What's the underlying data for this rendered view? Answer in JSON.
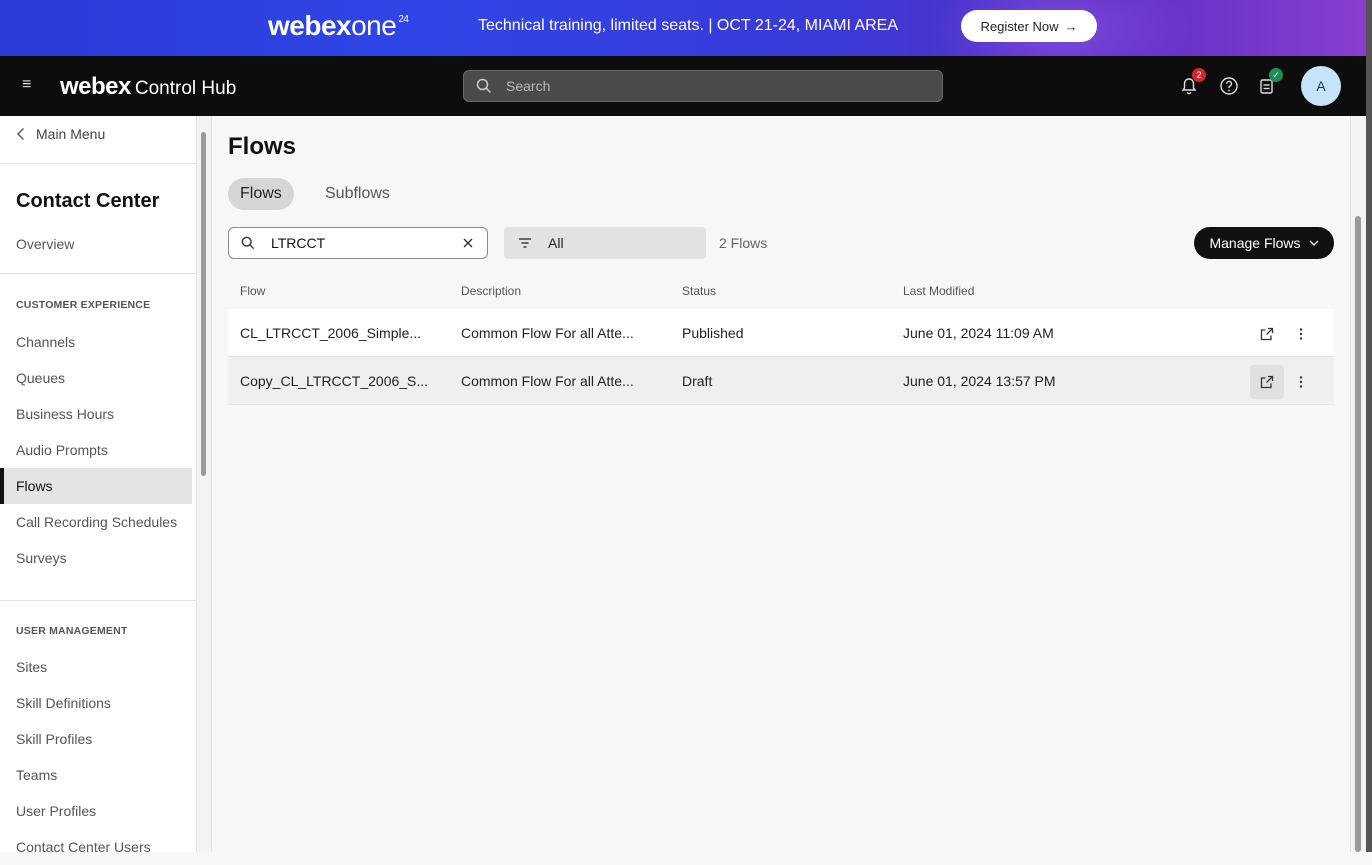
{
  "banner": {
    "logo_webex": "webex",
    "logo_one": "one",
    "logo_year": "24",
    "promo_text": "Technical training, limited seats. | OCT 21-24, MIAMI AREA",
    "register_label": "Register Now"
  },
  "topbar": {
    "brand": "webex",
    "product": "Control Hub",
    "search_placeholder": "Search",
    "notification_count": "2",
    "avatar_initial": "A"
  },
  "sidebar": {
    "main_menu": "Main Menu",
    "title": "Contact Center",
    "overview": "Overview",
    "section_customer_experience": "CUSTOMER EXPERIENCE",
    "cx_items": [
      "Channels",
      "Queues",
      "Business Hours",
      "Audio Prompts",
      "Flows",
      "Call Recording Schedules",
      "Surveys"
    ],
    "active_item": "Flows",
    "section_user_management": "USER MANAGEMENT",
    "um_items": [
      "Sites",
      "Skill Definitions",
      "Skill Profiles",
      "Teams",
      "User Profiles",
      "Contact Center Users"
    ]
  },
  "main": {
    "title": "Flows",
    "tabs": [
      {
        "label": "Flows",
        "active": true
      },
      {
        "label": "Subflows",
        "active": false
      }
    ],
    "search_value": "LTRCCT",
    "filter_value": "All",
    "count_text": "2 Flows",
    "manage_label": "Manage Flows",
    "columns": [
      "Flow",
      "Description",
      "Status",
      "Last Modified"
    ],
    "rows": [
      {
        "flow": "CL_LTRCCT_2006_Simple...",
        "description": "Common Flow For all Atte...",
        "status": "Published",
        "modified": "June 01, 2024 11:09 AM"
      },
      {
        "flow": "Copy_CL_LTRCCT_2006_S...",
        "description": "Common Flow For all Atte...",
        "status": "Draft",
        "modified": "June 01, 2024 13:57 PM"
      }
    ]
  }
}
